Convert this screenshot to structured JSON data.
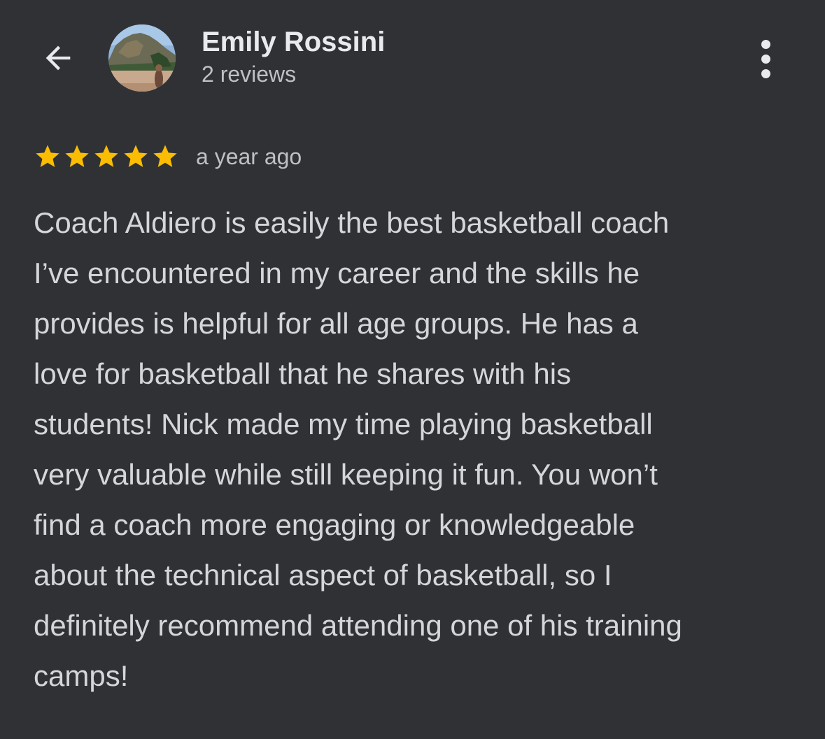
{
  "header": {
    "author_name": "Emily Rossini",
    "review_count": "2 reviews",
    "back_icon": "arrow-back-icon",
    "more_icon": "more-vert-icon"
  },
  "review": {
    "rating": 5,
    "rating_max": 5,
    "time_ago": "a year ago",
    "text_lines": [
      "Coach Aldiero is easily the best basketball coach",
      "I’ve encountered in my career and the skills he",
      "provides is helpful for all age groups. He has a",
      "love for basketball that he shares with his",
      "students! Nick made my time playing basketball",
      "very valuable while still keeping it fun. You won’t",
      "find a coach more engaging or knowledgeable",
      "about the technical aspect of basketball, so I",
      "definitely recommend attending one of his training",
      "camps!"
    ]
  },
  "colors": {
    "background": "#303134",
    "star": "#fbbc04",
    "primary_text": "#e8eaed",
    "secondary_text": "#bdc1c6"
  }
}
